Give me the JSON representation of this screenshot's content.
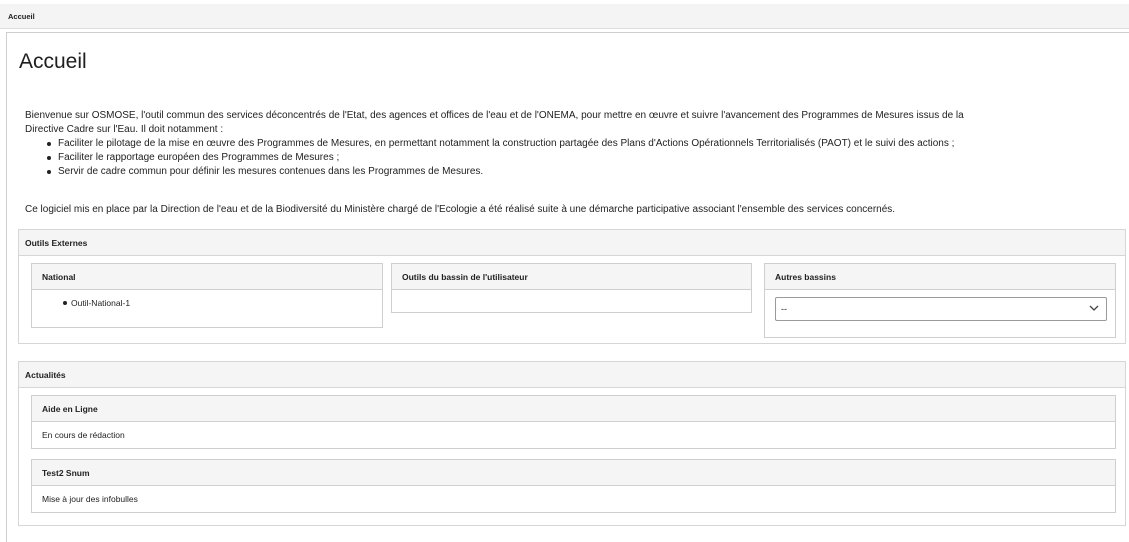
{
  "topbar": {
    "title": "Accueil"
  },
  "page": {
    "title": "Accueil"
  },
  "intro": {
    "paragraph_line1": "Bienvenue sur OSMOSE, l'outil commun des services déconcentrés de l'Etat, des agences et offices de l'eau et de l'ONEMA, pour mettre en œuvre et suivre l'avancement des Programmes de Mesures issus de la",
    "paragraph_line2": "Directive Cadre sur l'Eau. Il doit notamment :",
    "bullets": [
      "Faciliter le pilotage de la mise en œuvre des Programmes de Mesures, en permettant notamment la construction partagée des Plans d'Actions Opérationnels Territorialisés (PAOT) et le suivi des actions ;",
      "Faciliter le rapportage européen des Programmes de Mesures ;",
      "Servir de cadre commun pour définir les mesures contenues dans les Programmes de Mesures."
    ],
    "closing": "Ce logiciel mis en place par la Direction de l'eau et de la Biodiversité du Ministère chargé de l'Ecologie a été réalisé suite à une démarche participative associant l'ensemble des services concernés."
  },
  "outils_externes": {
    "title": "Outils Externes",
    "national": {
      "title": "National",
      "items": [
        "Outil-National-1"
      ]
    },
    "bassin_utilisateur": {
      "title": "Outils du bassin de l'utilisateur"
    },
    "autres_bassins": {
      "title": "Autres bassins",
      "select_value": "--",
      "icon": "chevron-down-icon"
    }
  },
  "actualites": {
    "title": "Actualités",
    "items": [
      {
        "title": "Aide en Ligne",
        "body": "En cours de rédaction"
      },
      {
        "title": "Test2 Snum",
        "body": "Mise à jour des infobulles"
      }
    ]
  }
}
